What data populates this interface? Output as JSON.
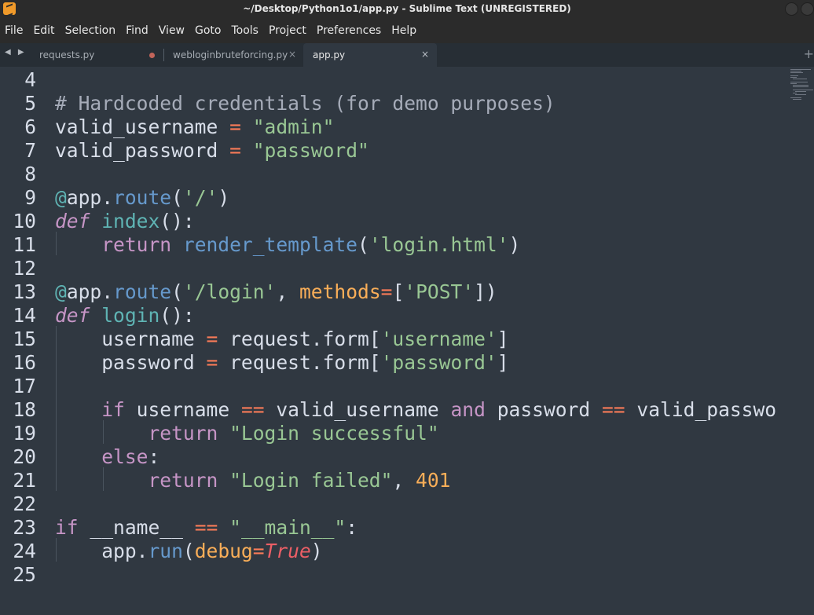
{
  "window": {
    "title": "~/Desktop/Python1o1/app.py - Sublime Text (UNREGISTERED)"
  },
  "menu": [
    "File",
    "Edit",
    "Selection",
    "Find",
    "View",
    "Goto",
    "Tools",
    "Project",
    "Preferences",
    "Help"
  ],
  "tabs": [
    {
      "label": "requests.py",
      "dirty": true,
      "active": false
    },
    {
      "label": "webloginbruteforcing.py",
      "dirty": false,
      "active": false
    },
    {
      "label": "app.py",
      "dirty": false,
      "active": true
    }
  ],
  "tab_arrows": "◀ ▶",
  "tab_close_glyph": "×",
  "tab_plus_glyph": "+",
  "editor": {
    "line_numbers": [
      "4",
      "5",
      "6",
      "7",
      "8",
      "9",
      "10",
      "11",
      "12",
      "13",
      "14",
      "15",
      "16",
      "17",
      "18",
      "19",
      "20",
      "21",
      "22",
      "23",
      "24",
      "25"
    ],
    "lines": [
      "",
      "# Hardcoded credentials (for demo purposes)",
      "valid_username = \"admin\"",
      "valid_password = \"password\"",
      "",
      "@app.route('/')",
      "def index():",
      "    return render_template('login.html')",
      "",
      "@app.route('/login', methods=['POST'])",
      "def login():",
      "    username = request.form['username']",
      "    password = request.form['password']",
      "",
      "    if username == valid_username and password == valid_passwo",
      "        return \"Login successful\"",
      "    else:",
      "        return \"Login failed\", 401",
      "",
      "if __name__ == \"__main__\":",
      "    app.run(debug=True)",
      ""
    ]
  },
  "colors": {
    "background": "#303841",
    "comment": "#a6acb9",
    "string": "#99c794",
    "operator": "#f97b58",
    "keyword": "#c695c6",
    "function": "#6699cc",
    "decorator": "#5fb4b4",
    "number": "#f9ae58"
  }
}
